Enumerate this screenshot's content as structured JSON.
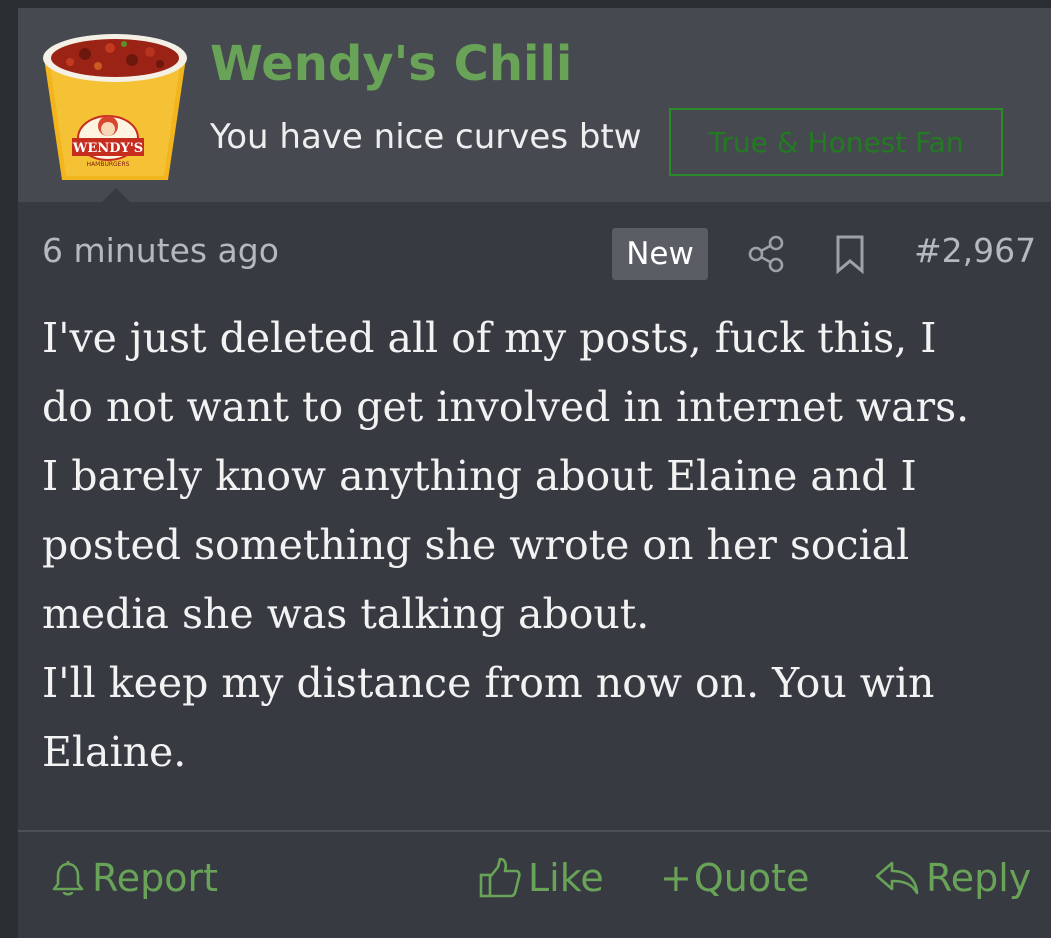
{
  "author": {
    "username": "Wendy's Chili",
    "user_title": "You have nice curves btw",
    "banner": "True & Honest Fan",
    "avatar_icon": "chili-cup-avatar",
    "avatar_logo_text": "WENDY'S",
    "avatar_sub_text": "HAMBURGERS"
  },
  "meta": {
    "time": "6 minutes ago",
    "badge": "New",
    "share_icon": "share-icon",
    "bookmark_icon": "bookmark-icon",
    "post_number": "#2,967"
  },
  "body": {
    "lines": [
      "I've just deleted all of my posts, fuck this, I",
      "do not want to get involved in internet wars.",
      "I barely know anything about Elaine and I",
      "posted something she wrote on her social",
      "media she was talking about.",
      "I'll keep my distance from now on. You win",
      "Elaine."
    ]
  },
  "actions": {
    "report": "Report",
    "like": "Like",
    "quote": "Quote",
    "reply": "Reply",
    "quote_prefix": "+"
  },
  "colors": {
    "accent_green": "#68a357",
    "banner_green": "#2a8a27",
    "header_bg": "#464950",
    "post_bg": "#373a41",
    "page_bg": "#2b2e33",
    "badge_bg": "#5a5d63"
  }
}
